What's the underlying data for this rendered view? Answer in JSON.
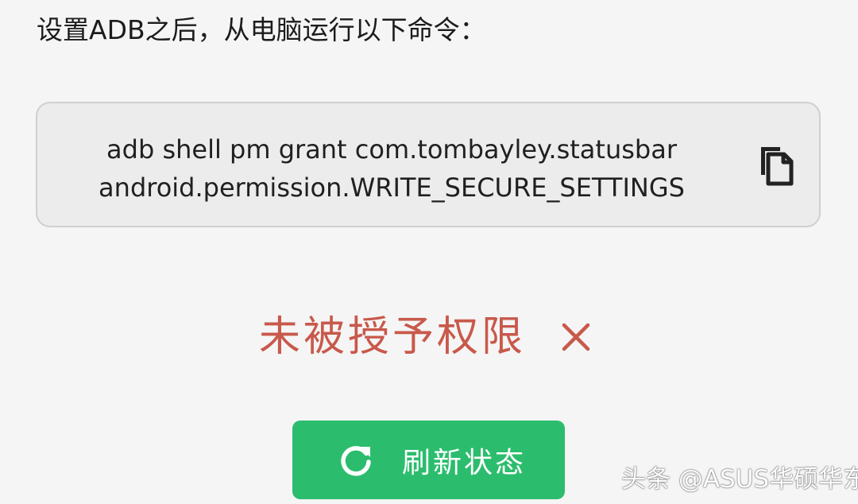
{
  "instruction": {
    "text": "设置ADB之后，从电脑运行以下命令："
  },
  "command": {
    "line1": "adb shell pm grant com.tombayley.statusbar",
    "line2": "android.permission.WRITE_SECURE_SETTINGS",
    "copy_icon": "copy-icon"
  },
  "status": {
    "text": "未被授予权限",
    "icon": "close-icon",
    "color": "#c8594b"
  },
  "refresh_button": {
    "label": "刷新状态",
    "icon": "refresh-icon",
    "color": "#2bbd6d"
  },
  "watermark": {
    "text": "头条 @ASUS华硕华东"
  }
}
